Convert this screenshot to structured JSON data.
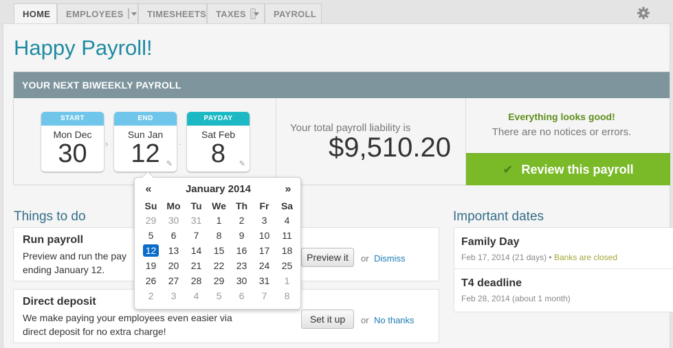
{
  "nav": {
    "tabs": [
      "HOME",
      "EMPLOYEES",
      "TIMESHEETS",
      "TAXES",
      "PAYROLL"
    ],
    "settings_icon": "gear-icon"
  },
  "page": {
    "title": "Happy Payroll!"
  },
  "next_payroll": {
    "header": "YOUR NEXT BIWEEKLY PAYROLL",
    "start": {
      "label": "START",
      "dow": "Mon Dec",
      "day": "30"
    },
    "end": {
      "label": "END",
      "dow": "Sun Jan",
      "day": "12"
    },
    "payday": {
      "label": "PAYDAY",
      "dow": "Sat Feb",
      "day": "8"
    },
    "liability_label": "Your total payroll liability is",
    "liability_amount": "$9,510.20",
    "status_title": "Everything looks good!",
    "status_sub": "There are no notices or errors.",
    "review_label": "Review this payroll"
  },
  "todo": {
    "title": "Things to do",
    "items": [
      {
        "title": "Run payroll",
        "text1": "Preview and run the pay",
        "text2": "ending January 12.",
        "button": "Preview it",
        "or": "or",
        "link": "Dismiss"
      },
      {
        "title": "Direct deposit",
        "text1": "We make paying your employees even easier via",
        "text2": "direct deposit for no extra charge!",
        "button": "Set it up",
        "or": "or",
        "link": "No thanks"
      }
    ]
  },
  "important": {
    "title": "Important dates",
    "items": [
      {
        "title": "Family Day",
        "meta": "Feb 17, 2014 (21 days)",
        "dot": "•",
        "note": "Banks are closed"
      },
      {
        "title": "T4 deadline",
        "meta": "Feb 28, 2014 (about 1 month)"
      }
    ]
  },
  "datepicker": {
    "prev": "«",
    "next": "»",
    "month": "January 2014",
    "days": [
      "Su",
      "Mo",
      "Tu",
      "We",
      "Th",
      "Fr",
      "Sa"
    ],
    "weeks": [
      [
        "29",
        "30",
        "31",
        "1",
        "2",
        "3",
        "4"
      ],
      [
        "5",
        "6",
        "7",
        "8",
        "9",
        "10",
        "11"
      ],
      [
        "12",
        "13",
        "14",
        "15",
        "16",
        "17",
        "18"
      ],
      [
        "19",
        "20",
        "21",
        "22",
        "23",
        "24",
        "25"
      ],
      [
        "26",
        "27",
        "28",
        "29",
        "30",
        "31",
        "1"
      ],
      [
        "2",
        "3",
        "4",
        "5",
        "6",
        "7",
        "8"
      ]
    ],
    "selected": "12"
  },
  "colors": {
    "accent": "#1f8aa3",
    "green": "#7ab928",
    "header_bar": "#7e959d",
    "selected_day": "#0a6bc9"
  }
}
